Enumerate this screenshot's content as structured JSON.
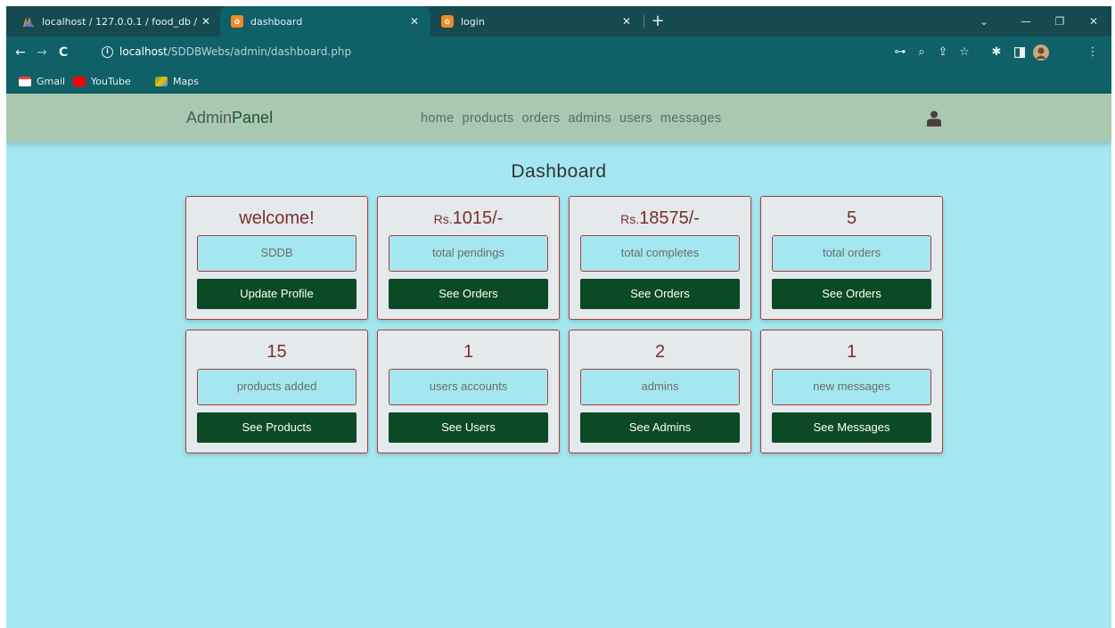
{
  "browser": {
    "tabs": [
      {
        "label": "localhost / 127.0.0.1 / food_db / ",
        "favicon": "phpmyadmin-icon",
        "active": false
      },
      {
        "label": "dashboard",
        "favicon": "xampp-icon",
        "active": true
      },
      {
        "label": "login",
        "favicon": "xampp-icon",
        "active": false
      }
    ],
    "url_host": "localhost",
    "url_path": "/SDDBWebs/admin/dashboard.php",
    "bookmarks": [
      "Gmail",
      "YouTube",
      "Maps"
    ]
  },
  "header": {
    "logo_part1": "Admin",
    "logo_part2": "Panel",
    "nav": [
      "home",
      "products",
      "orders",
      "admins",
      "users",
      "messages"
    ]
  },
  "page_title": "Dashboard",
  "cards": [
    {
      "title_prefix": "",
      "title": "welcome!",
      "box": "SDDB",
      "button": "Update Profile"
    },
    {
      "title_prefix": "Rs.",
      "title": "1015/-",
      "box": "total pendings",
      "button": "See Orders"
    },
    {
      "title_prefix": "Rs.",
      "title": "18575/-",
      "box": "total completes",
      "button": "See Orders"
    },
    {
      "title_prefix": "",
      "title": "5",
      "box": "total orders",
      "button": "See Orders"
    },
    {
      "title_prefix": "",
      "title": "15",
      "box": "products added",
      "button": "See Products"
    },
    {
      "title_prefix": "",
      "title": "1",
      "box": "users accounts",
      "button": "See Users"
    },
    {
      "title_prefix": "",
      "title": "2",
      "box": "admins",
      "button": "See Admins"
    },
    {
      "title_prefix": "",
      "title": "1",
      "box": "new messages",
      "button": "See Messages"
    }
  ],
  "colors": {
    "page_bg": "#a5e7f0",
    "header_bg": "#a8c8b0",
    "card_border": "#a5413d",
    "button_bg": "#0b4a24",
    "title_color": "#7a2f2e"
  }
}
